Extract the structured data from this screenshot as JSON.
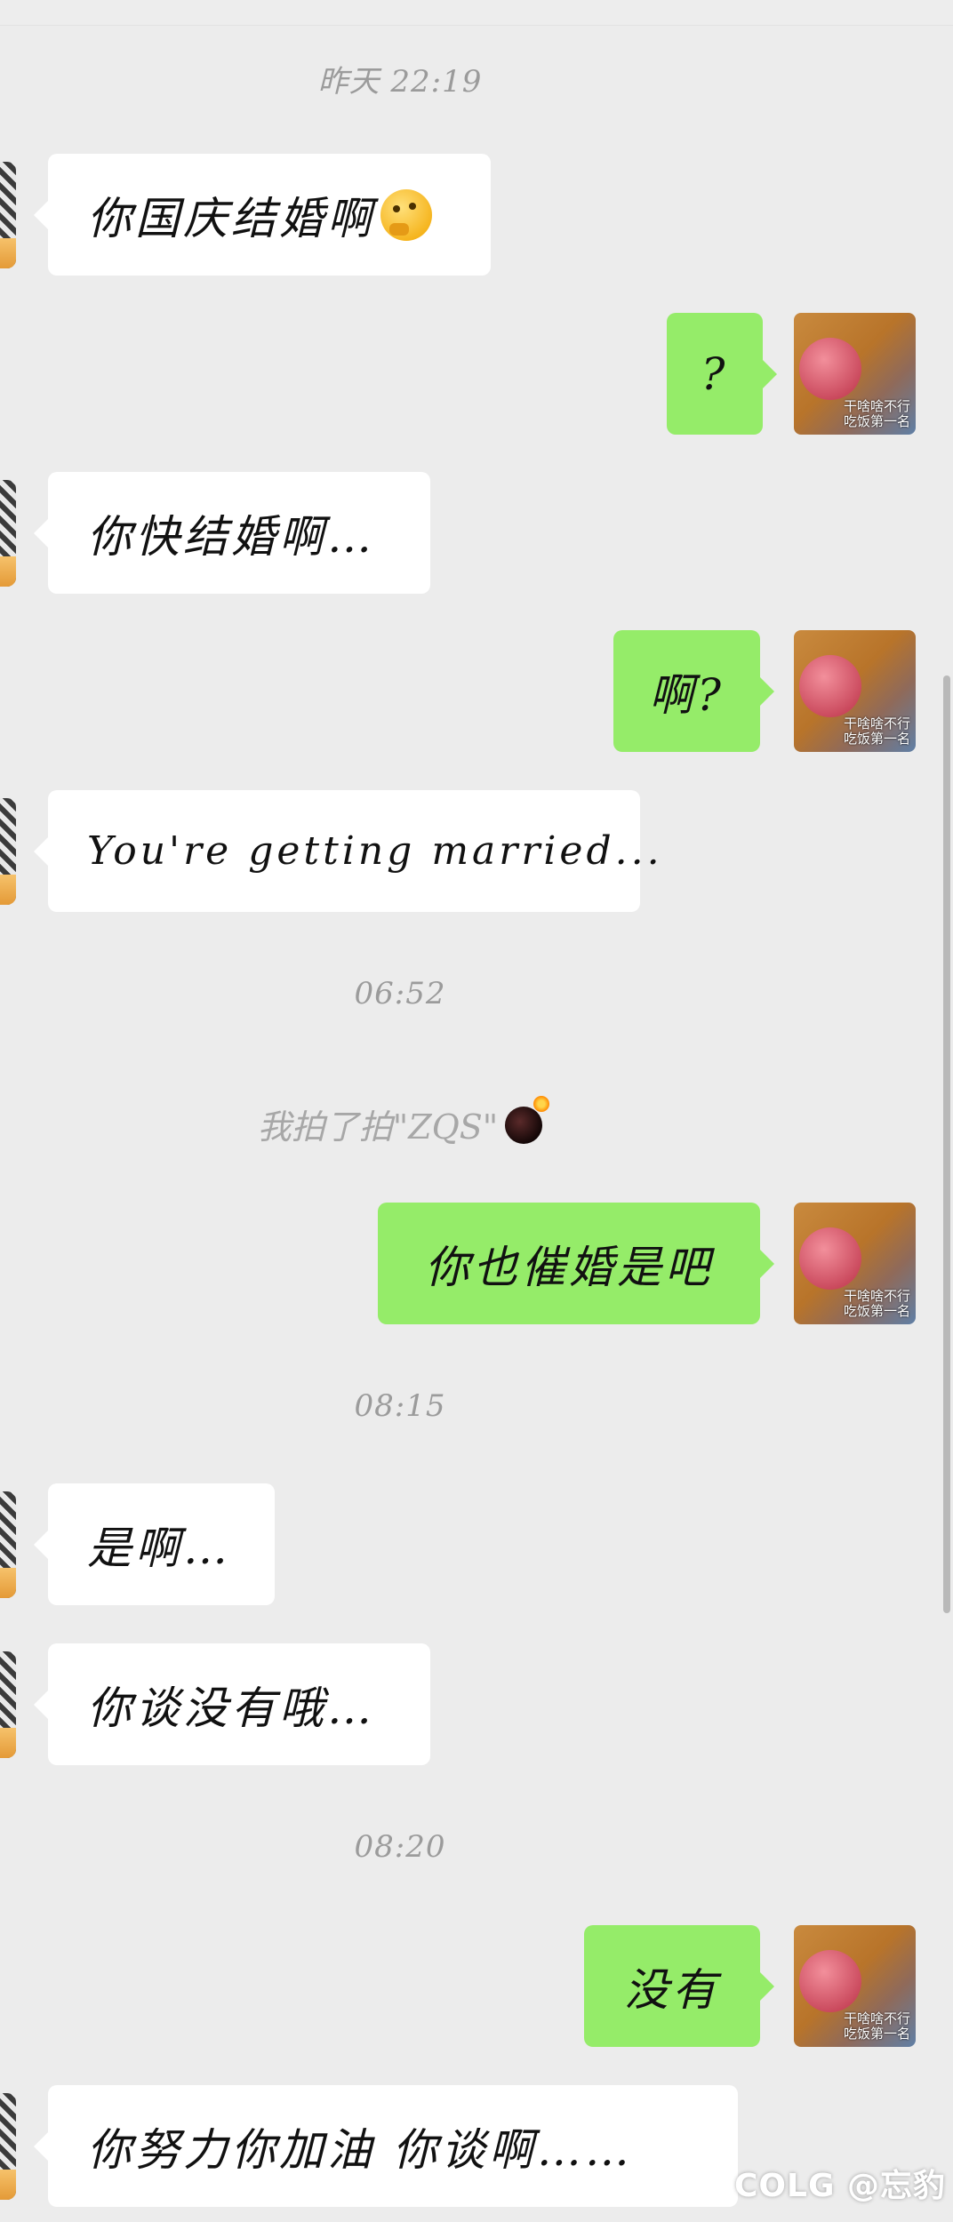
{
  "timestamps": [
    "昨天 22:19",
    "06:52",
    "08:15",
    "08:20"
  ],
  "system_message": "我拍了拍\"ZQS\"",
  "messages": [
    {
      "side": "left",
      "text": "你国庆结婚啊",
      "emoji": "thinking-face"
    },
    {
      "side": "right",
      "text": "?"
    },
    {
      "side": "left",
      "text": "你快结婚啊…"
    },
    {
      "side": "right",
      "text": "啊?"
    },
    {
      "side": "left",
      "text": "You're getting married..."
    },
    {
      "side": "right",
      "text": "你也催婚是吧"
    },
    {
      "side": "left",
      "text": "是啊…"
    },
    {
      "side": "left",
      "text": "你谈没有哦…"
    },
    {
      "side": "right",
      "text": "没有"
    },
    {
      "side": "left",
      "text": "你努力你加油  你谈啊……"
    }
  ],
  "avatar_caption_line1": "干啥啥不行",
  "avatar_caption_line2": "吃饭第一名",
  "watermark": "COLG @忘豹",
  "colors": {
    "background": "#ececec",
    "incoming_bubble": "#ffffff",
    "outgoing_bubble": "#95ec69",
    "timestamp_text": "#9b9b9b"
  },
  "icons": {
    "system_message_icon": "bomb-icon",
    "emoji_in_first_message": "thinking-face-icon"
  }
}
